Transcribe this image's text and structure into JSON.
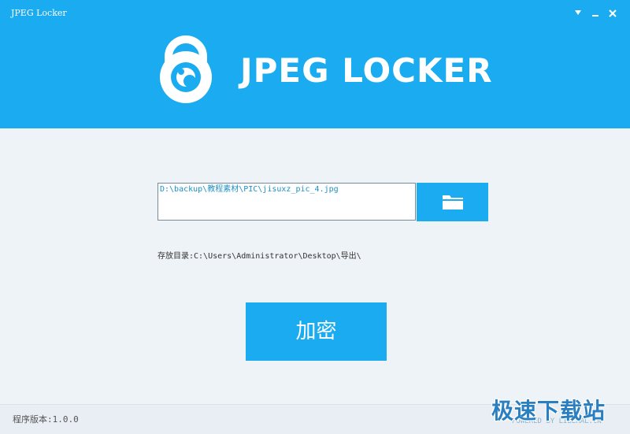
{
  "window": {
    "title": "JPEG Locker",
    "controls": {
      "dropdown_icon": "triangle-down-icon",
      "minimize_icon": "minimize-icon",
      "close_icon": "close-icon"
    }
  },
  "header": {
    "logo_icon": "lock-eye-logo",
    "brand": "JPEG LOCKER",
    "background": "#1aabf0"
  },
  "file_input": {
    "value": "D:\\backup\\教程素材\\PIC\\jisuxz_pic_4.jpg",
    "browse_icon": "folder-icon"
  },
  "save_dir": {
    "text": "存放目录:C:\\Users\\Administrator\\Desktop\\导出\\"
  },
  "actions": {
    "encrypt_label": "加密"
  },
  "footer": {
    "version": "程序版本:1.0.0",
    "powered": "POWERED BY LIBERAL.CN"
  },
  "watermark": {
    "text": "极速下载站"
  },
  "colors": {
    "accent": "#1aabf0",
    "background": "#eef3f8"
  }
}
